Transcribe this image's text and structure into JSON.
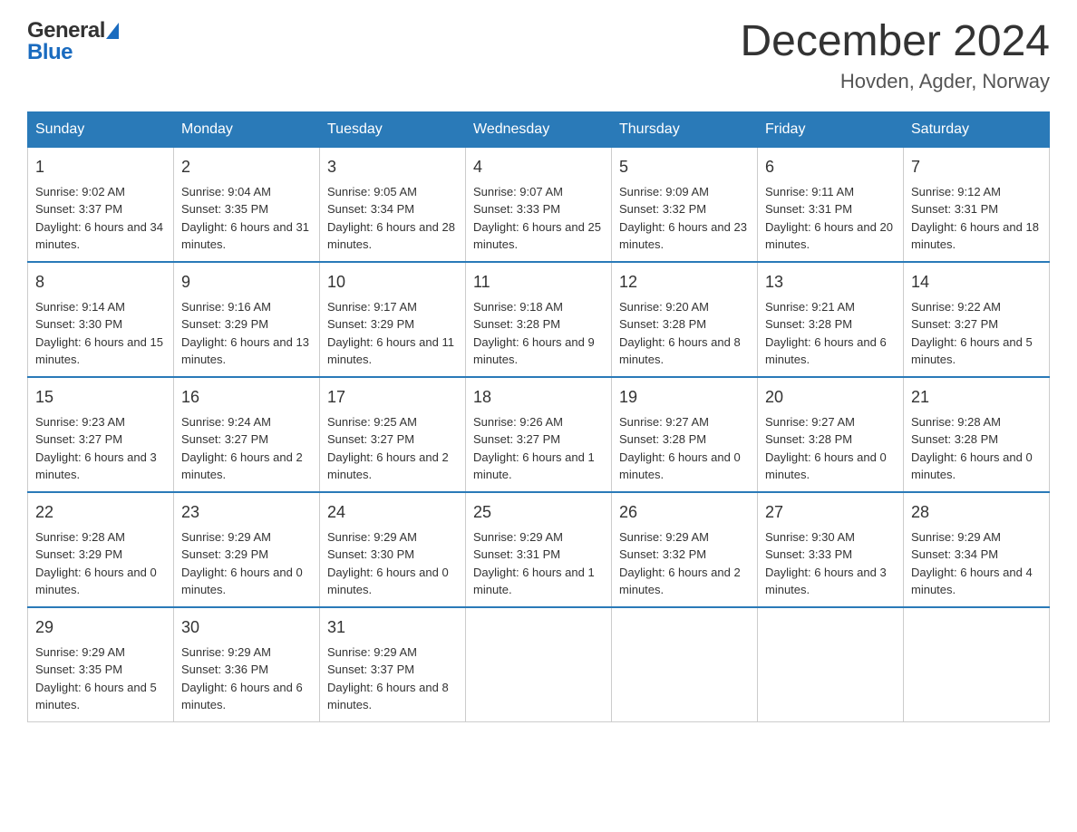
{
  "header": {
    "logo_general": "General",
    "logo_blue": "Blue",
    "month_title": "December 2024",
    "location": "Hovden, Agder, Norway"
  },
  "days_of_week": [
    "Sunday",
    "Monday",
    "Tuesday",
    "Wednesday",
    "Thursday",
    "Friday",
    "Saturday"
  ],
  "weeks": [
    [
      {
        "day": "1",
        "sunrise": "Sunrise: 9:02 AM",
        "sunset": "Sunset: 3:37 PM",
        "daylight": "Daylight: 6 hours and 34 minutes."
      },
      {
        "day": "2",
        "sunrise": "Sunrise: 9:04 AM",
        "sunset": "Sunset: 3:35 PM",
        "daylight": "Daylight: 6 hours and 31 minutes."
      },
      {
        "day": "3",
        "sunrise": "Sunrise: 9:05 AM",
        "sunset": "Sunset: 3:34 PM",
        "daylight": "Daylight: 6 hours and 28 minutes."
      },
      {
        "day": "4",
        "sunrise": "Sunrise: 9:07 AM",
        "sunset": "Sunset: 3:33 PM",
        "daylight": "Daylight: 6 hours and 25 minutes."
      },
      {
        "day": "5",
        "sunrise": "Sunrise: 9:09 AM",
        "sunset": "Sunset: 3:32 PM",
        "daylight": "Daylight: 6 hours and 23 minutes."
      },
      {
        "day": "6",
        "sunrise": "Sunrise: 9:11 AM",
        "sunset": "Sunset: 3:31 PM",
        "daylight": "Daylight: 6 hours and 20 minutes."
      },
      {
        "day": "7",
        "sunrise": "Sunrise: 9:12 AM",
        "sunset": "Sunset: 3:31 PM",
        "daylight": "Daylight: 6 hours and 18 minutes."
      }
    ],
    [
      {
        "day": "8",
        "sunrise": "Sunrise: 9:14 AM",
        "sunset": "Sunset: 3:30 PM",
        "daylight": "Daylight: 6 hours and 15 minutes."
      },
      {
        "day": "9",
        "sunrise": "Sunrise: 9:16 AM",
        "sunset": "Sunset: 3:29 PM",
        "daylight": "Daylight: 6 hours and 13 minutes."
      },
      {
        "day": "10",
        "sunrise": "Sunrise: 9:17 AM",
        "sunset": "Sunset: 3:29 PM",
        "daylight": "Daylight: 6 hours and 11 minutes."
      },
      {
        "day": "11",
        "sunrise": "Sunrise: 9:18 AM",
        "sunset": "Sunset: 3:28 PM",
        "daylight": "Daylight: 6 hours and 9 minutes."
      },
      {
        "day": "12",
        "sunrise": "Sunrise: 9:20 AM",
        "sunset": "Sunset: 3:28 PM",
        "daylight": "Daylight: 6 hours and 8 minutes."
      },
      {
        "day": "13",
        "sunrise": "Sunrise: 9:21 AM",
        "sunset": "Sunset: 3:28 PM",
        "daylight": "Daylight: 6 hours and 6 minutes."
      },
      {
        "day": "14",
        "sunrise": "Sunrise: 9:22 AM",
        "sunset": "Sunset: 3:27 PM",
        "daylight": "Daylight: 6 hours and 5 minutes."
      }
    ],
    [
      {
        "day": "15",
        "sunrise": "Sunrise: 9:23 AM",
        "sunset": "Sunset: 3:27 PM",
        "daylight": "Daylight: 6 hours and 3 minutes."
      },
      {
        "day": "16",
        "sunrise": "Sunrise: 9:24 AM",
        "sunset": "Sunset: 3:27 PM",
        "daylight": "Daylight: 6 hours and 2 minutes."
      },
      {
        "day": "17",
        "sunrise": "Sunrise: 9:25 AM",
        "sunset": "Sunset: 3:27 PM",
        "daylight": "Daylight: 6 hours and 2 minutes."
      },
      {
        "day": "18",
        "sunrise": "Sunrise: 9:26 AM",
        "sunset": "Sunset: 3:27 PM",
        "daylight": "Daylight: 6 hours and 1 minute."
      },
      {
        "day": "19",
        "sunrise": "Sunrise: 9:27 AM",
        "sunset": "Sunset: 3:28 PM",
        "daylight": "Daylight: 6 hours and 0 minutes."
      },
      {
        "day": "20",
        "sunrise": "Sunrise: 9:27 AM",
        "sunset": "Sunset: 3:28 PM",
        "daylight": "Daylight: 6 hours and 0 minutes."
      },
      {
        "day": "21",
        "sunrise": "Sunrise: 9:28 AM",
        "sunset": "Sunset: 3:28 PM",
        "daylight": "Daylight: 6 hours and 0 minutes."
      }
    ],
    [
      {
        "day": "22",
        "sunrise": "Sunrise: 9:28 AM",
        "sunset": "Sunset: 3:29 PM",
        "daylight": "Daylight: 6 hours and 0 minutes."
      },
      {
        "day": "23",
        "sunrise": "Sunrise: 9:29 AM",
        "sunset": "Sunset: 3:29 PM",
        "daylight": "Daylight: 6 hours and 0 minutes."
      },
      {
        "day": "24",
        "sunrise": "Sunrise: 9:29 AM",
        "sunset": "Sunset: 3:30 PM",
        "daylight": "Daylight: 6 hours and 0 minutes."
      },
      {
        "day": "25",
        "sunrise": "Sunrise: 9:29 AM",
        "sunset": "Sunset: 3:31 PM",
        "daylight": "Daylight: 6 hours and 1 minute."
      },
      {
        "day": "26",
        "sunrise": "Sunrise: 9:29 AM",
        "sunset": "Sunset: 3:32 PM",
        "daylight": "Daylight: 6 hours and 2 minutes."
      },
      {
        "day": "27",
        "sunrise": "Sunrise: 9:30 AM",
        "sunset": "Sunset: 3:33 PM",
        "daylight": "Daylight: 6 hours and 3 minutes."
      },
      {
        "day": "28",
        "sunrise": "Sunrise: 9:29 AM",
        "sunset": "Sunset: 3:34 PM",
        "daylight": "Daylight: 6 hours and 4 minutes."
      }
    ],
    [
      {
        "day": "29",
        "sunrise": "Sunrise: 9:29 AM",
        "sunset": "Sunset: 3:35 PM",
        "daylight": "Daylight: 6 hours and 5 minutes."
      },
      {
        "day": "30",
        "sunrise": "Sunrise: 9:29 AM",
        "sunset": "Sunset: 3:36 PM",
        "daylight": "Daylight: 6 hours and 6 minutes."
      },
      {
        "day": "31",
        "sunrise": "Sunrise: 9:29 AM",
        "sunset": "Sunset: 3:37 PM",
        "daylight": "Daylight: 6 hours and 8 minutes."
      },
      null,
      null,
      null,
      null
    ]
  ]
}
